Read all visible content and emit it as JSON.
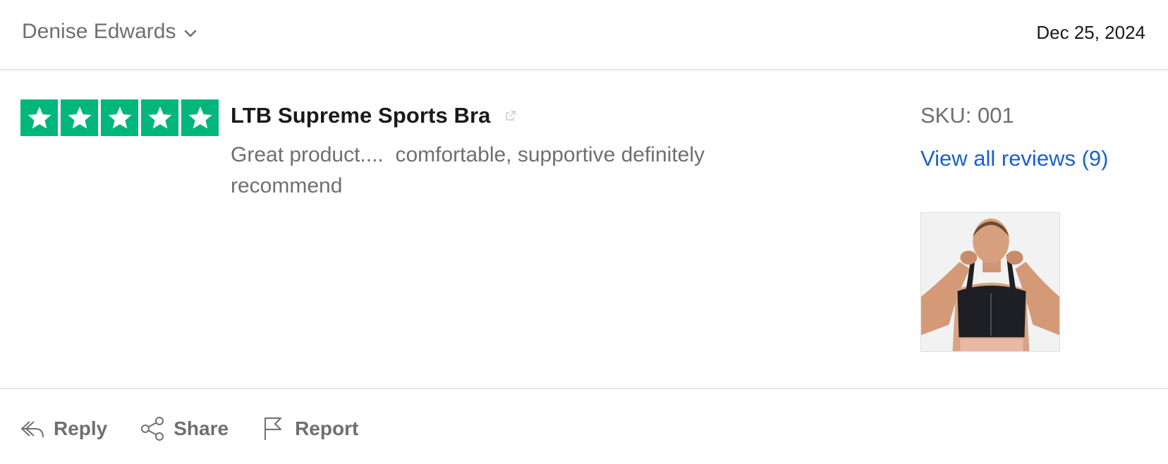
{
  "header": {
    "author_name": "Denise Edwards",
    "date": "Dec 25, 2024"
  },
  "rating": {
    "stars": 5,
    "max": 5,
    "color": "#00b67a"
  },
  "product": {
    "title": "LTB Supreme Sports Bra",
    "review_text": "Great product....  comfortable, supportive definitely recommend",
    "sku": "SKU: 001",
    "view_all": "View all reviews (9)",
    "link_color": "#1a5fd1"
  },
  "actions": [
    {
      "label": "Reply",
      "icon": "reply-icon"
    },
    {
      "label": "Share",
      "icon": "share-icon"
    },
    {
      "label": "Report",
      "icon": "flag-icon"
    }
  ]
}
